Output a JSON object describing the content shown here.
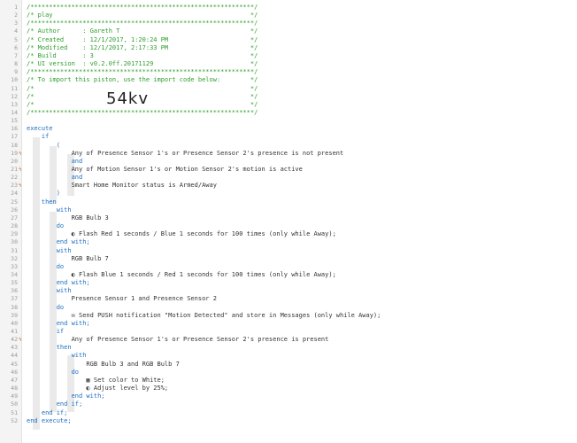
{
  "code_lines": [
    {
      "n": "1",
      "m": "",
      "t": "/************************************************************/"
    },
    {
      "n": "2",
      "m": "",
      "t": "/* play                                                     */"
    },
    {
      "n": "3",
      "m": "",
      "t": "/************************************************************/"
    },
    {
      "n": "4",
      "m": "",
      "t": "/* Author      : Gareth T                                   */"
    },
    {
      "n": "5",
      "m": "",
      "t": "/* Created     : 12/1/2017, 1:20:24 PM                      */"
    },
    {
      "n": "6",
      "m": "",
      "t": "/* Modified    : 12/1/2017, 2:17:33 PM                      */"
    },
    {
      "n": "7",
      "m": "",
      "t": "/* Build       : 3                                          */"
    },
    {
      "n": "8",
      "m": "",
      "t": "/* UI version  : v0.2.0ff.20171129                          */"
    },
    {
      "n": "9",
      "m": "",
      "t": "/************************************************************/"
    },
    {
      "n": "10",
      "m": "",
      "t": "/* To import this piston, use the import code below:        */"
    },
    {
      "n": "11",
      "m": "",
      "t": "/*                                                          */"
    },
    {
      "n": "12",
      "m": "",
      "t": "/*                                                          */"
    },
    {
      "n": "13",
      "m": "",
      "t": "/*                                                          */"
    },
    {
      "n": "14",
      "m": "",
      "t": "/************************************************************/"
    },
    {
      "n": "15",
      "m": "",
      "t": ""
    },
    {
      "n": "16",
      "m": "",
      "t": "execute"
    },
    {
      "n": "17",
      "m": "",
      "t": "    if"
    },
    {
      "n": "18",
      "m": "",
      "t": "        ("
    },
    {
      "n": "19",
      "m": "ϟ",
      "t": "            Any of Presence Sensor 1's or Presence Sensor 2's presence is not present"
    },
    {
      "n": "20",
      "m": "",
      "t": "            and"
    },
    {
      "n": "21",
      "m": "ϟ",
      "t": "            Any of Motion Sensor 1's or Motion Sensor 2's motion is active"
    },
    {
      "n": "22",
      "m": "",
      "t": "            and"
    },
    {
      "n": "23",
      "m": "ϟ",
      "t": "            Smart Home Monitor status is Armed/Away"
    },
    {
      "n": "24",
      "m": "",
      "t": "        )"
    },
    {
      "n": "25",
      "m": "",
      "t": "    then"
    },
    {
      "n": "26",
      "m": "",
      "t": "        with"
    },
    {
      "n": "27",
      "m": "",
      "t": "            RGB Bulb 3"
    },
    {
      "n": "28",
      "m": "",
      "t": "        do"
    },
    {
      "n": "29",
      "m": "",
      "t": "            ◐ Flash Red 1 seconds / Blue 1 seconds for 100 times (only while Away);"
    },
    {
      "n": "30",
      "m": "",
      "t": "        end with;"
    },
    {
      "n": "31",
      "m": "",
      "t": "        with"
    },
    {
      "n": "32",
      "m": "",
      "t": "            RGB Bulb 7"
    },
    {
      "n": "33",
      "m": "",
      "t": "        do"
    },
    {
      "n": "34",
      "m": "",
      "t": "            ◐ Flash Blue 1 seconds / Red 1 seconds for 100 times (only while Away);"
    },
    {
      "n": "35",
      "m": "",
      "t": "        end with;"
    },
    {
      "n": "36",
      "m": "",
      "t": "        with"
    },
    {
      "n": "37",
      "m": "",
      "t": "            Presence Sensor 1 and Presence Sensor 2"
    },
    {
      "n": "38",
      "m": "",
      "t": "        do"
    },
    {
      "n": "39",
      "m": "",
      "t": "            ✉ Send PUSH notification \"Motion Detected\" and store in Messages (only while Away);"
    },
    {
      "n": "40",
      "m": "",
      "t": "        end with;"
    },
    {
      "n": "41",
      "m": "",
      "t": "        if"
    },
    {
      "n": "42",
      "m": "ϟ",
      "t": "            Any of Presence Sensor 1's or Presence Sensor 2's presence is present"
    },
    {
      "n": "43",
      "m": "",
      "t": "        then"
    },
    {
      "n": "44",
      "m": "",
      "t": "            with"
    },
    {
      "n": "45",
      "m": "",
      "t": "                RGB Bulb 3 and RGB Bulb 7"
    },
    {
      "n": "46",
      "m": "",
      "t": "            do"
    },
    {
      "n": "47",
      "m": "",
      "t": "                ▦ Set color to White;"
    },
    {
      "n": "48",
      "m": "",
      "t": "                ◐ Adjust level by 25%;"
    },
    {
      "n": "49",
      "m": "",
      "t": "            end with;"
    },
    {
      "n": "50",
      "m": "",
      "t": "        end if;"
    },
    {
      "n": "51",
      "m": "",
      "t": "    end if;"
    },
    {
      "n": "52",
      "m": "",
      "t": "end execute;"
    }
  ],
  "import_code": "54kv",
  "colors": {
    "comment": "#2e9e2e",
    "keyword": "#1f6fbf",
    "device": "#9333c9",
    "value": "#c0392b",
    "trigger_marker": "#e0563b"
  }
}
